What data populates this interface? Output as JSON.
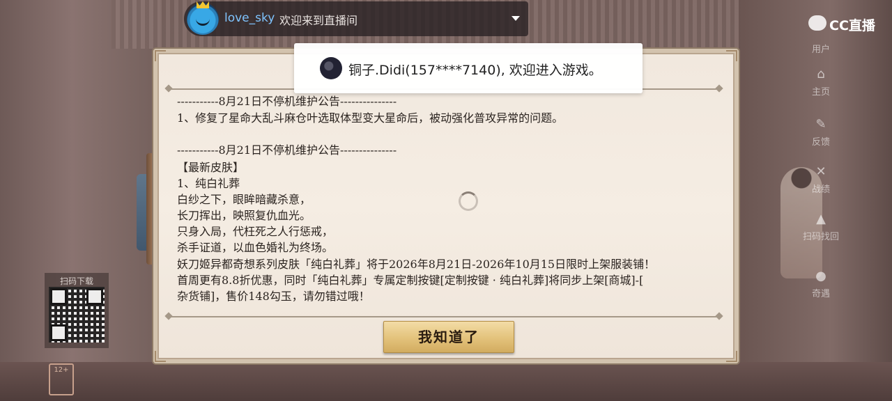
{
  "overlay": {
    "username": "love_sky",
    "welcome_message": "欢迎来到直播间",
    "brand": "CC直播"
  },
  "side_menu": {
    "items": [
      {
        "label": "用户",
        "icon": "user-icon"
      },
      {
        "label": "主页",
        "icon": "home-icon"
      },
      {
        "label": "反馈",
        "icon": "feedback-icon"
      },
      {
        "label": "战绩",
        "icon": "battle-icon"
      },
      {
        "label": "扫码找回",
        "icon": "qrcode-recover-icon"
      },
      {
        "label": "奇遇",
        "icon": "adventure-icon"
      }
    ]
  },
  "qr": {
    "label": "扫码下载"
  },
  "age_rating": {
    "label": "12+"
  },
  "toast": {
    "text": "铜子.Didi(157****7140), 欢迎进入游戏。"
  },
  "notice": {
    "block1_header": "-----------8月21日不停机维护公告---------------",
    "block1_line1": "1、修复了星命大乱斗麻仓叶选取体型变大星命后，被动强化普攻异常的问题。",
    "block2_header": "-----------8月21日不停机维护公告---------------",
    "section_title": "【最新皮肤】",
    "skin_name": "1、纯白礼葬",
    "poem_1": "白纱之下，眼眸暗藏杀意，",
    "poem_2": "长刀挥出，映照复仇血光。",
    "poem_3": "只身入局，代枉死之人行惩戒，",
    "poem_4": "杀手证道，以血色婚礼为终场。",
    "line_sale": "妖刀姬异都奇想系列皮肤「纯白礼葬」将于2026年8月21日-2026年10月15日限时上架服装铺！",
    "line_discount_1": "首周更有8.8折优惠，同时「纯白礼葬」专属定制按键[定制按键 · 纯白礼葬]将同步上架[商城]-[",
    "line_discount_2": "杂货铺]，售价148勾玉，请勿错过哦！"
  },
  "dialog": {
    "confirm_label": "我知道了"
  },
  "colors": {
    "username": "#7fc4ff",
    "button_gold": "#e3c27b",
    "paper": "#f3ebe1"
  }
}
